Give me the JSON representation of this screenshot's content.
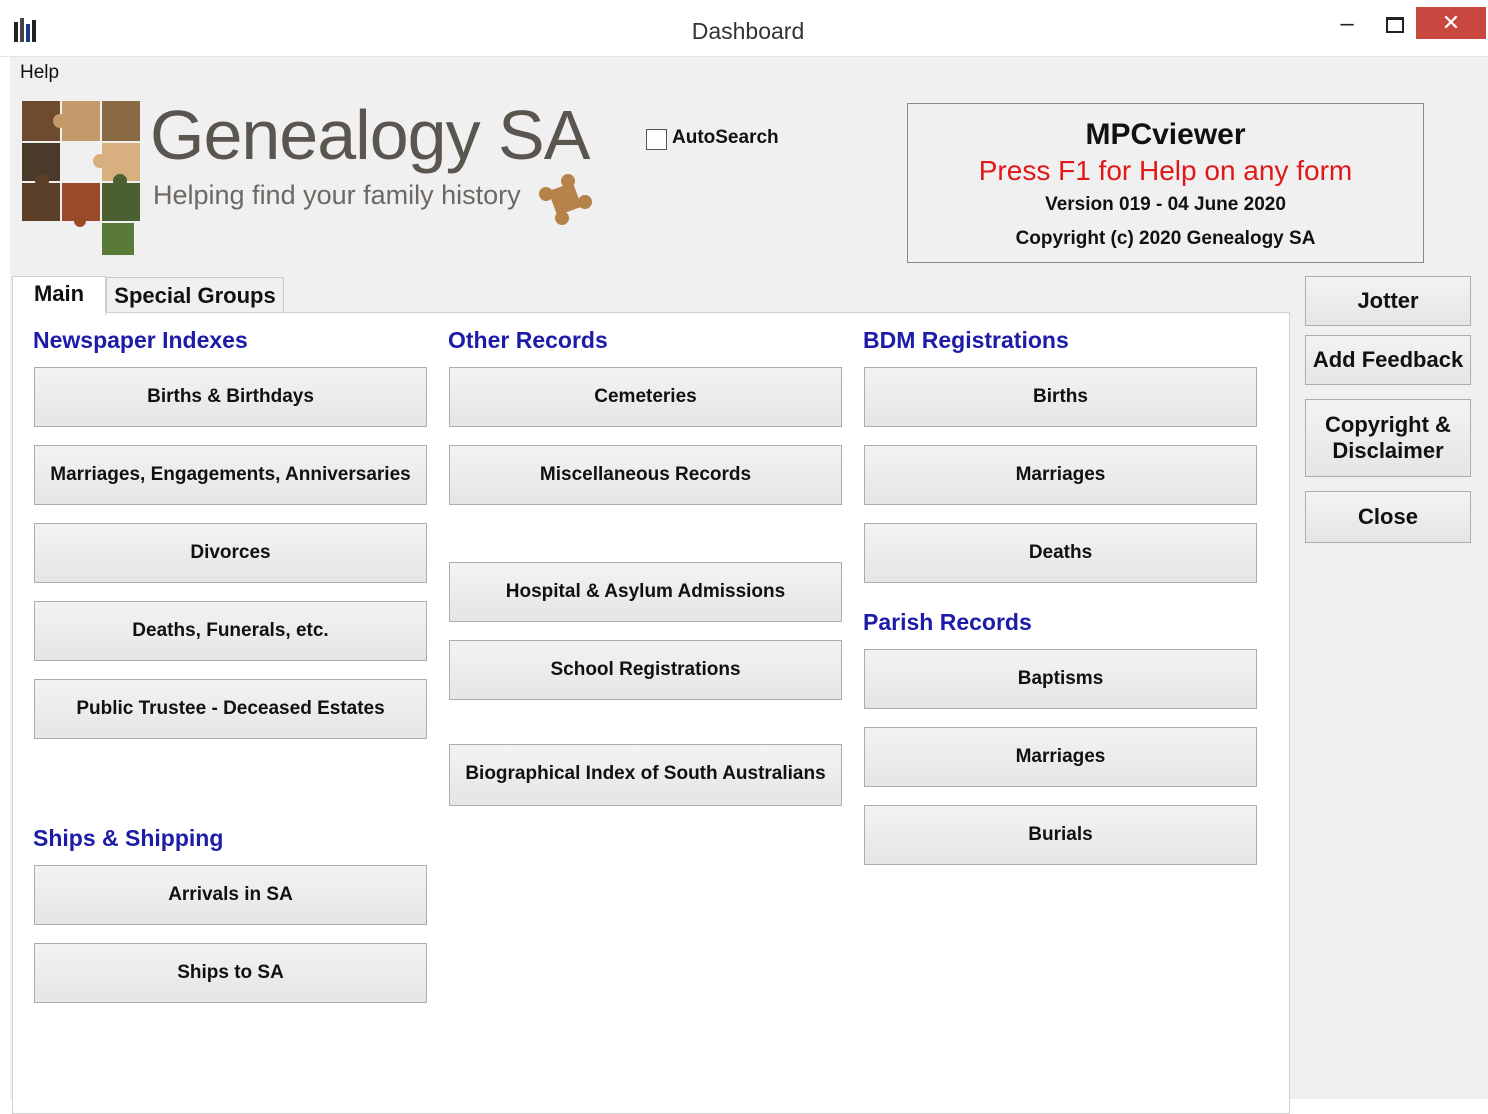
{
  "window": {
    "title": "Dashboard",
    "minimize": "–",
    "close": "✕"
  },
  "menu": {
    "help": "Help"
  },
  "header": {
    "logo_title": "Genealogy SA",
    "logo_subtitle": "Helping find your family history",
    "autosearch_label": "AutoSearch",
    "autosearch_checked": false,
    "app_name": "MPCviewer",
    "help_hint": "Press F1 for Help on any form",
    "version": "Version 019 - 04 June 2020",
    "copyright": "Copyright (c) 2020 Genealogy SA"
  },
  "tabs": {
    "main": "Main",
    "special": "Special Groups"
  },
  "newspaper": {
    "heading": "Newspaper Indexes",
    "births": "Births & Birthdays",
    "marriages": "Marriages, Engagements, Anniversaries",
    "divorces": "Divorces",
    "deaths": "Deaths, Funerals, etc.",
    "trustee": "Public Trustee - Deceased Estates"
  },
  "ships": {
    "heading": "Ships & Shipping",
    "arrivals": "Arrivals in SA",
    "ships": "Ships to SA"
  },
  "other": {
    "heading": "Other Records",
    "cemeteries": "Cemeteries",
    "misc": "Miscellaneous Records",
    "hospital": "Hospital & Asylum Admissions",
    "school": "School Registrations",
    "bio": "Biographical Index of South Australians"
  },
  "bdm": {
    "heading": "BDM Registrations",
    "births": "Births",
    "marriages": "Marriages",
    "deaths": "Deaths"
  },
  "parish": {
    "heading": "Parish Records",
    "baptisms": "Baptisms",
    "marriages": "Marriages",
    "burials": "Burials"
  },
  "side": {
    "jotter": "Jotter",
    "feedback": "Add Feedback",
    "copyright_line1": "Copyright &",
    "copyright_line2": "Disclaimer",
    "close": "Close"
  },
  "colors": {
    "section_heading": "#1c1ca8",
    "help_hint": "#e01818",
    "close_button": "#c8483f"
  }
}
